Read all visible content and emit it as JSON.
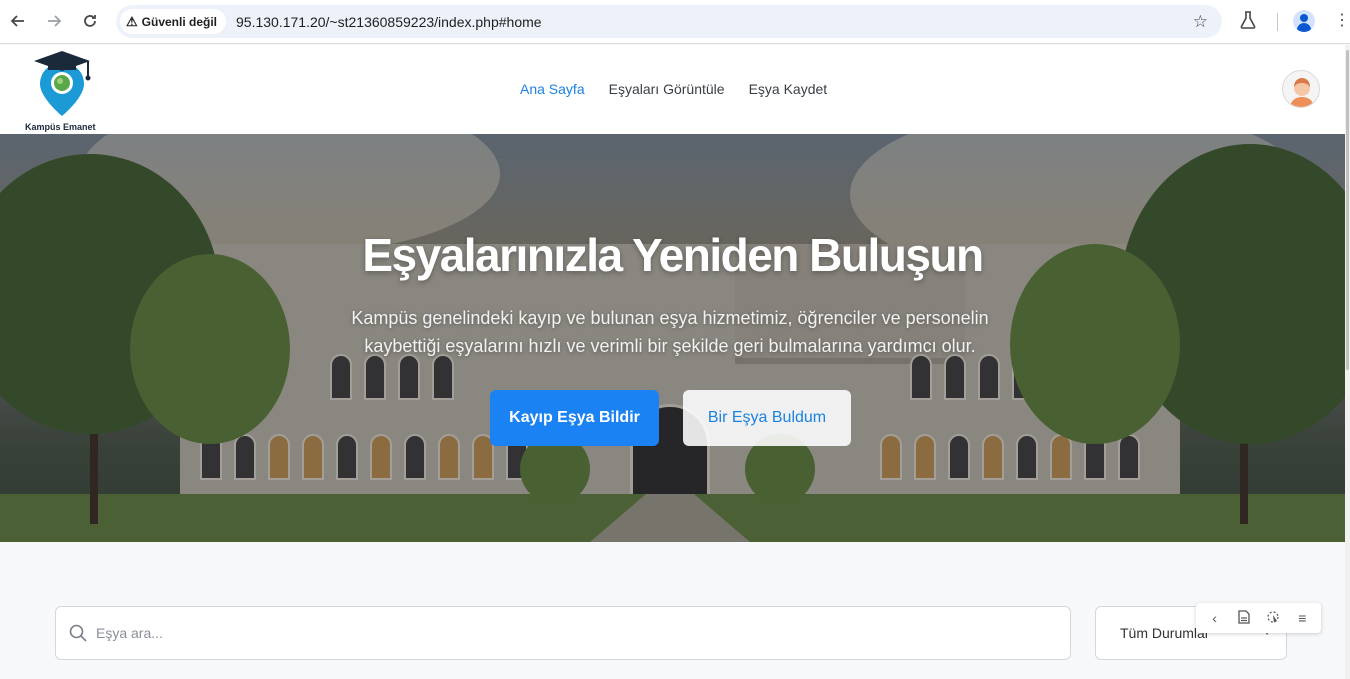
{
  "browser": {
    "security_label": "Güvenli değil",
    "url": "95.130.171.20/~st21360859223/index.php#home",
    "icons": [
      "back-arrow-icon",
      "forward-arrow-icon",
      "reload-icon",
      "warning-icon",
      "star-icon",
      "labs-flask-icon",
      "profile-icon",
      "kebab-menu-icon"
    ]
  },
  "header": {
    "logo_text": "Kampüs Emanet",
    "nav": [
      {
        "label": "Ana Sayfa",
        "active": true
      },
      {
        "label": "Eşyaları Görüntüle",
        "active": false
      },
      {
        "label": "Eşya Kaydet",
        "active": false
      }
    ]
  },
  "hero": {
    "title": "Eşyalarınızla Yeniden Buluşun",
    "subtitle": "Kampüs genelindeki kayıp ve bulunan eşya hizmetimiz, öğrenciler ve personelin kaybettiği eşyalarını hızlı ve verimli bir şekilde geri bulmalarına yardımcı olur.",
    "primary_button": "Kayıp Eşya Bildir",
    "secondary_button": "Bir Eşya Buldum"
  },
  "search": {
    "placeholder": "Eşya ara...",
    "status_selected": "Tüm Durumlar"
  },
  "colors": {
    "accent": "#1a82f2",
    "nav_active": "#1a82e2"
  }
}
